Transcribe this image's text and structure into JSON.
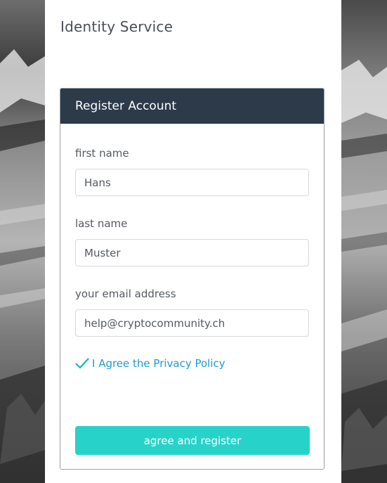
{
  "header": {
    "app_title": "Identity Service"
  },
  "card": {
    "title": "Register Account",
    "fields": {
      "first_name": {
        "label": "first name",
        "value": "Hans"
      },
      "last_name": {
        "label": "last name",
        "value": "Muster"
      },
      "email": {
        "label": "your email address",
        "value": "help@cryptocommunity.ch"
      }
    },
    "privacy": {
      "label": "I Agree the Privacy Policy",
      "checked": true
    },
    "submit_label": "agree and register"
  },
  "colors": {
    "header_bg": "#2c3a4a",
    "accent_button": "#27d3c9",
    "link": "#1f9bd1",
    "check": "#18b8a8"
  },
  "icons": {
    "check": "check-icon"
  }
}
